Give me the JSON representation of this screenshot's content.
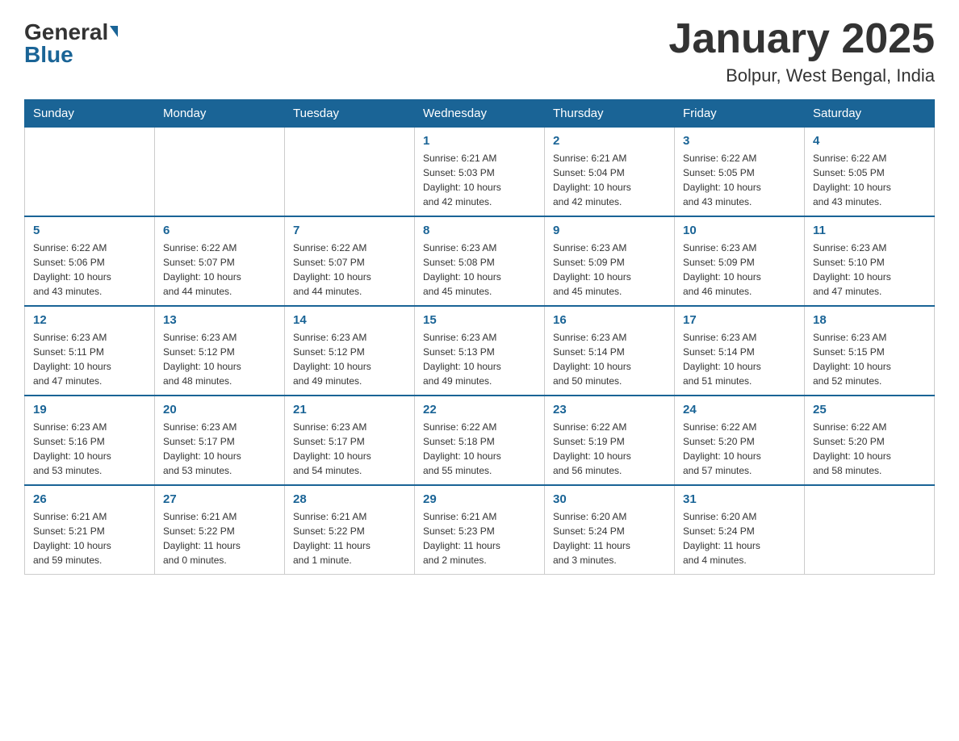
{
  "logo": {
    "general_text": "General",
    "blue_text": "Blue"
  },
  "header": {
    "month_year": "January 2025",
    "location": "Bolpur, West Bengal, India"
  },
  "days_of_week": [
    "Sunday",
    "Monday",
    "Tuesday",
    "Wednesday",
    "Thursday",
    "Friday",
    "Saturday"
  ],
  "weeks": [
    {
      "days": [
        {
          "num": "",
          "info": ""
        },
        {
          "num": "",
          "info": ""
        },
        {
          "num": "",
          "info": ""
        },
        {
          "num": "1",
          "info": "Sunrise: 6:21 AM\nSunset: 5:03 PM\nDaylight: 10 hours\nand 42 minutes."
        },
        {
          "num": "2",
          "info": "Sunrise: 6:21 AM\nSunset: 5:04 PM\nDaylight: 10 hours\nand 42 minutes."
        },
        {
          "num": "3",
          "info": "Sunrise: 6:22 AM\nSunset: 5:05 PM\nDaylight: 10 hours\nand 43 minutes."
        },
        {
          "num": "4",
          "info": "Sunrise: 6:22 AM\nSunset: 5:05 PM\nDaylight: 10 hours\nand 43 minutes."
        }
      ]
    },
    {
      "days": [
        {
          "num": "5",
          "info": "Sunrise: 6:22 AM\nSunset: 5:06 PM\nDaylight: 10 hours\nand 43 minutes."
        },
        {
          "num": "6",
          "info": "Sunrise: 6:22 AM\nSunset: 5:07 PM\nDaylight: 10 hours\nand 44 minutes."
        },
        {
          "num": "7",
          "info": "Sunrise: 6:22 AM\nSunset: 5:07 PM\nDaylight: 10 hours\nand 44 minutes."
        },
        {
          "num": "8",
          "info": "Sunrise: 6:23 AM\nSunset: 5:08 PM\nDaylight: 10 hours\nand 45 minutes."
        },
        {
          "num": "9",
          "info": "Sunrise: 6:23 AM\nSunset: 5:09 PM\nDaylight: 10 hours\nand 45 minutes."
        },
        {
          "num": "10",
          "info": "Sunrise: 6:23 AM\nSunset: 5:09 PM\nDaylight: 10 hours\nand 46 minutes."
        },
        {
          "num": "11",
          "info": "Sunrise: 6:23 AM\nSunset: 5:10 PM\nDaylight: 10 hours\nand 47 minutes."
        }
      ]
    },
    {
      "days": [
        {
          "num": "12",
          "info": "Sunrise: 6:23 AM\nSunset: 5:11 PM\nDaylight: 10 hours\nand 47 minutes."
        },
        {
          "num": "13",
          "info": "Sunrise: 6:23 AM\nSunset: 5:12 PM\nDaylight: 10 hours\nand 48 minutes."
        },
        {
          "num": "14",
          "info": "Sunrise: 6:23 AM\nSunset: 5:12 PM\nDaylight: 10 hours\nand 49 minutes."
        },
        {
          "num": "15",
          "info": "Sunrise: 6:23 AM\nSunset: 5:13 PM\nDaylight: 10 hours\nand 49 minutes."
        },
        {
          "num": "16",
          "info": "Sunrise: 6:23 AM\nSunset: 5:14 PM\nDaylight: 10 hours\nand 50 minutes."
        },
        {
          "num": "17",
          "info": "Sunrise: 6:23 AM\nSunset: 5:14 PM\nDaylight: 10 hours\nand 51 minutes."
        },
        {
          "num": "18",
          "info": "Sunrise: 6:23 AM\nSunset: 5:15 PM\nDaylight: 10 hours\nand 52 minutes."
        }
      ]
    },
    {
      "days": [
        {
          "num": "19",
          "info": "Sunrise: 6:23 AM\nSunset: 5:16 PM\nDaylight: 10 hours\nand 53 minutes."
        },
        {
          "num": "20",
          "info": "Sunrise: 6:23 AM\nSunset: 5:17 PM\nDaylight: 10 hours\nand 53 minutes."
        },
        {
          "num": "21",
          "info": "Sunrise: 6:23 AM\nSunset: 5:17 PM\nDaylight: 10 hours\nand 54 minutes."
        },
        {
          "num": "22",
          "info": "Sunrise: 6:22 AM\nSunset: 5:18 PM\nDaylight: 10 hours\nand 55 minutes."
        },
        {
          "num": "23",
          "info": "Sunrise: 6:22 AM\nSunset: 5:19 PM\nDaylight: 10 hours\nand 56 minutes."
        },
        {
          "num": "24",
          "info": "Sunrise: 6:22 AM\nSunset: 5:20 PM\nDaylight: 10 hours\nand 57 minutes."
        },
        {
          "num": "25",
          "info": "Sunrise: 6:22 AM\nSunset: 5:20 PM\nDaylight: 10 hours\nand 58 minutes."
        }
      ]
    },
    {
      "days": [
        {
          "num": "26",
          "info": "Sunrise: 6:21 AM\nSunset: 5:21 PM\nDaylight: 10 hours\nand 59 minutes."
        },
        {
          "num": "27",
          "info": "Sunrise: 6:21 AM\nSunset: 5:22 PM\nDaylight: 11 hours\nand 0 minutes."
        },
        {
          "num": "28",
          "info": "Sunrise: 6:21 AM\nSunset: 5:22 PM\nDaylight: 11 hours\nand 1 minute."
        },
        {
          "num": "29",
          "info": "Sunrise: 6:21 AM\nSunset: 5:23 PM\nDaylight: 11 hours\nand 2 minutes."
        },
        {
          "num": "30",
          "info": "Sunrise: 6:20 AM\nSunset: 5:24 PM\nDaylight: 11 hours\nand 3 minutes."
        },
        {
          "num": "31",
          "info": "Sunrise: 6:20 AM\nSunset: 5:24 PM\nDaylight: 11 hours\nand 4 minutes."
        },
        {
          "num": "",
          "info": ""
        }
      ]
    }
  ]
}
